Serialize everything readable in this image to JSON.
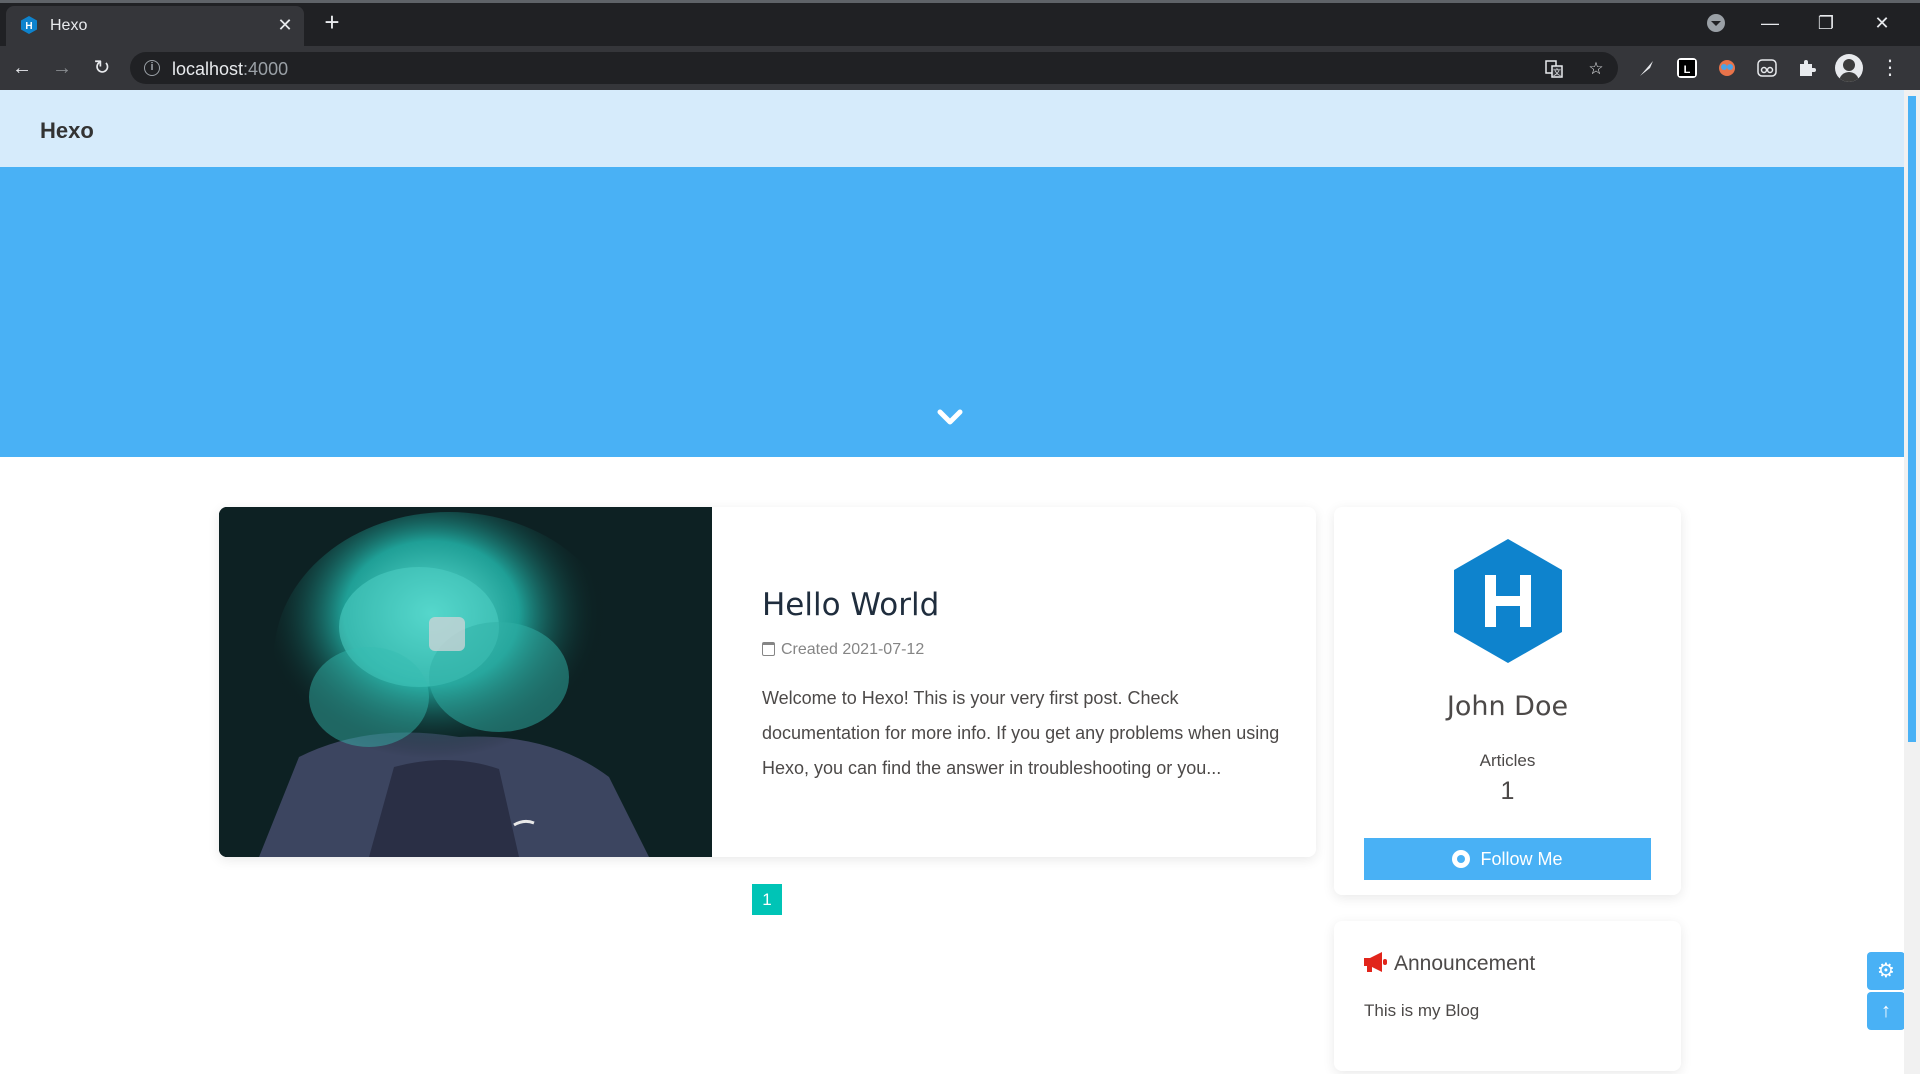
{
  "browser": {
    "tab_title": "Hexo",
    "tab_close": "✕",
    "new_tab": "+",
    "url_host": "localhost",
    "url_port": ":4000",
    "window_minimize": "—",
    "window_restore": "❐",
    "window_close": "✕",
    "back": "←",
    "forward": "→",
    "reload": "↻",
    "translate_icon": "translate-icon",
    "bookmark_icon": "☆",
    "extensions_icon": "puzzle-icon",
    "menu": "⋮",
    "accent": "#35363a"
  },
  "site": {
    "title": "Hexo",
    "hero_color": "#49b1f5",
    "navbar_color": "#d6ebfb"
  },
  "post": {
    "title": "Hello World",
    "created_label": "Created 2021-07-12",
    "excerpt": "Welcome to Hexo! This is your very first post. Check documentation for more info. If you get any problems when using Hexo, you can find the answer in troubleshooting or you..."
  },
  "pagination": {
    "current": "1",
    "color": "#00c4b6"
  },
  "author": {
    "name": "John Doe",
    "articles_label": "Articles",
    "articles_count": "1",
    "follow_label": "Follow Me",
    "avatar_letter": "H",
    "avatar_color": "#0e83cd"
  },
  "announcement": {
    "title": "Announcement",
    "text": "This is my Blog"
  },
  "rightside": {
    "settings_icon": "⚙",
    "top_icon": "↑"
  }
}
